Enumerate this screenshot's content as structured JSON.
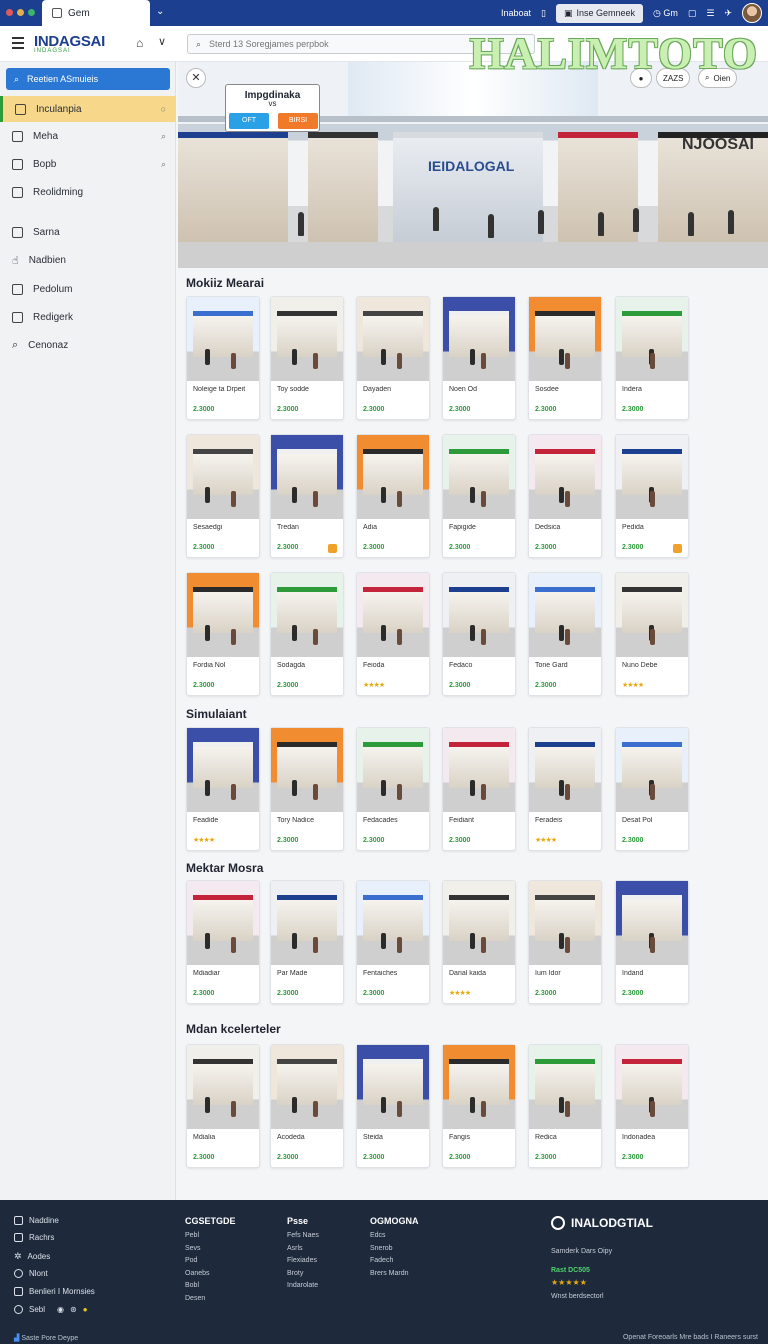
{
  "browser": {
    "tab_title": "Gem",
    "actions": {
      "a1": "Inaboat",
      "chip": "Inse Gemneek",
      "a3": "Gm"
    }
  },
  "header": {
    "logo": "INDAGSAI",
    "logo_sub": "INDAGSAI",
    "search_placeholder": "Sterd 13 Soregjames perpbok",
    "watermark": "HALIMTOTO"
  },
  "sidebar": {
    "search_label": "Reetien ASmuieis",
    "items": [
      {
        "label": "Inculanpia",
        "icon": "document-icon"
      },
      {
        "label": "Meha",
        "icon": "document-icon"
      },
      {
        "label": "Bopb",
        "icon": "square-icon"
      },
      {
        "label": "Reolidming",
        "icon": "document-icon"
      },
      {
        "label": "Sarna",
        "icon": "document-icon"
      },
      {
        "label": "Nadbien",
        "icon": "hand-icon"
      },
      {
        "label": "Pedolum",
        "icon": "document-icon"
      },
      {
        "label": "Redigerk",
        "icon": "document-icon"
      },
      {
        "label": "Cenonaz",
        "icon": "search-icon"
      }
    ]
  },
  "hero": {
    "promo_title": "Impgdinaka",
    "promo_sub": "vs",
    "btn1": "OFT",
    "btn2": "BIRSI",
    "right_btn1": "ZAZS",
    "right_btn2": "Oien",
    "center_sign": "IEIDALOGAL",
    "right_sign": "NJOOSAI"
  },
  "sections": [
    {
      "title": "Mokiiz Mearai",
      "rows": [
        [
          {
            "name": "Noleige ta Drpeit",
            "price": "2.3000",
            "kind": "price"
          },
          {
            "name": "Toy sodde",
            "price": "2.3000",
            "kind": "price"
          },
          {
            "name": "Dayaden",
            "price": "2.3000",
            "kind": "price"
          },
          {
            "name": "Noen Od",
            "price": "2.3000",
            "kind": "price"
          },
          {
            "name": "Sosdee",
            "price": "2.3000",
            "kind": "price"
          },
          {
            "name": "Indera",
            "price": "2.3000",
            "kind": "price"
          }
        ],
        [
          {
            "name": "Sesaedgi",
            "price": "2.3000",
            "kind": "price"
          },
          {
            "name": "Tredan",
            "price": "2.3000",
            "kind": "price",
            "badge": true
          },
          {
            "name": "Adia",
            "price": "2.3000",
            "kind": "price"
          },
          {
            "name": "Fapigide",
            "price": "2.3000",
            "kind": "price"
          },
          {
            "name": "Dedsica",
            "price": "2.3000",
            "kind": "price"
          },
          {
            "name": "Pedida",
            "price": "2.3000",
            "kind": "price",
            "badge": true
          }
        ],
        [
          {
            "name": "Fordia Nol",
            "price": "2.3000",
            "kind": "price"
          },
          {
            "name": "Sodagda",
            "price": "2.3000",
            "kind": "price"
          },
          {
            "name": "Feioda",
            "stars": "★★★★",
            "kind": "stars"
          },
          {
            "name": "Fedaco",
            "price": "2.3000",
            "kind": "price"
          },
          {
            "name": "Tone Gard",
            "price": "2.3000",
            "kind": "price"
          },
          {
            "name": "Nuno Debe",
            "stars": "★★★★",
            "kind": "stars"
          }
        ]
      ]
    },
    {
      "title": "Simulaiant",
      "rows": [
        [
          {
            "name": "Feadide",
            "stars": "★★★★",
            "kind": "stars"
          },
          {
            "name": "Tory Nadice",
            "price": "2.3000",
            "kind": "price"
          },
          {
            "name": "Fedacades",
            "price": "2.3000",
            "kind": "price"
          },
          {
            "name": "Feidiant",
            "price": "2.3000",
            "kind": "price"
          },
          {
            "name": "Feradeis",
            "stars": "★★★★",
            "kind": "stars"
          },
          {
            "name": "Desat Pol",
            "price": "2.3000",
            "kind": "price"
          }
        ]
      ]
    },
    {
      "title": "Mektar Mosra",
      "rows": [
        [
          {
            "name": "Mdiadiar",
            "price": "2.3000",
            "kind": "price"
          },
          {
            "name": "Par Made",
            "price": "2.3000",
            "kind": "price"
          },
          {
            "name": "Fentaiches",
            "price": "2.3000",
            "kind": "price"
          },
          {
            "name": "Darial kaida",
            "stars": "★★★★",
            "kind": "stars"
          },
          {
            "name": "Ium Idor",
            "price": "2.3000",
            "kind": "price"
          },
          {
            "name": "Indand",
            "price": "2.3000",
            "kind": "price"
          }
        ]
      ]
    },
    {
      "title": "Mdan kcelerteler",
      "rows": [
        [
          {
            "name": "Mdialia",
            "price": "2.3000",
            "kind": "price"
          },
          {
            "name": "Acodeda",
            "price": "2.3000",
            "kind": "price"
          },
          {
            "name": "Steida",
            "price": "2.3000",
            "kind": "price"
          },
          {
            "name": "Fangis",
            "price": "2.3000",
            "kind": "price"
          },
          {
            "name": "Redica",
            "price": "2.3000",
            "kind": "price"
          },
          {
            "name": "Indonadea",
            "price": "2.3000",
            "kind": "price"
          }
        ]
      ]
    }
  ],
  "footer": {
    "left_items": [
      "Naddine",
      "Rachrs",
      "Aodes",
      "Nlont",
      "Benlieri I Mornsies",
      "Sebl"
    ],
    "col1": {
      "h": "CGSETGDE",
      "links": [
        "Pebl",
        "Sevs",
        "Pod",
        "Oanebs",
        "Bobl",
        "Desen"
      ]
    },
    "col2": {
      "h": "Psse",
      "links": [
        "Fefs Naes",
        "Asrls",
        "Flexiades",
        "Broty",
        "Indarolate"
      ]
    },
    "col3": {
      "h": "OGMOGNA",
      "links": [
        "Edcs",
        "Snerob",
        "Fadech",
        "Brers Mardn"
      ]
    },
    "brand": "INALODGTIAL",
    "brand_line": "Samderk Dars Oipy",
    "brand_green": "Rast DC505",
    "brand_stars": "★★★★★",
    "brand_bottom": "Wnst berdsectorl",
    "bottom_left": "Saste Pore Deype",
    "bottom_right": "Openat Foreoarls Mre bads I Raneers surst"
  },
  "colors": {
    "primary": "#1d3f8f",
    "accent": "#2a78d4",
    "green": "#2e9b3b",
    "footer": "#1e2a3c"
  }
}
